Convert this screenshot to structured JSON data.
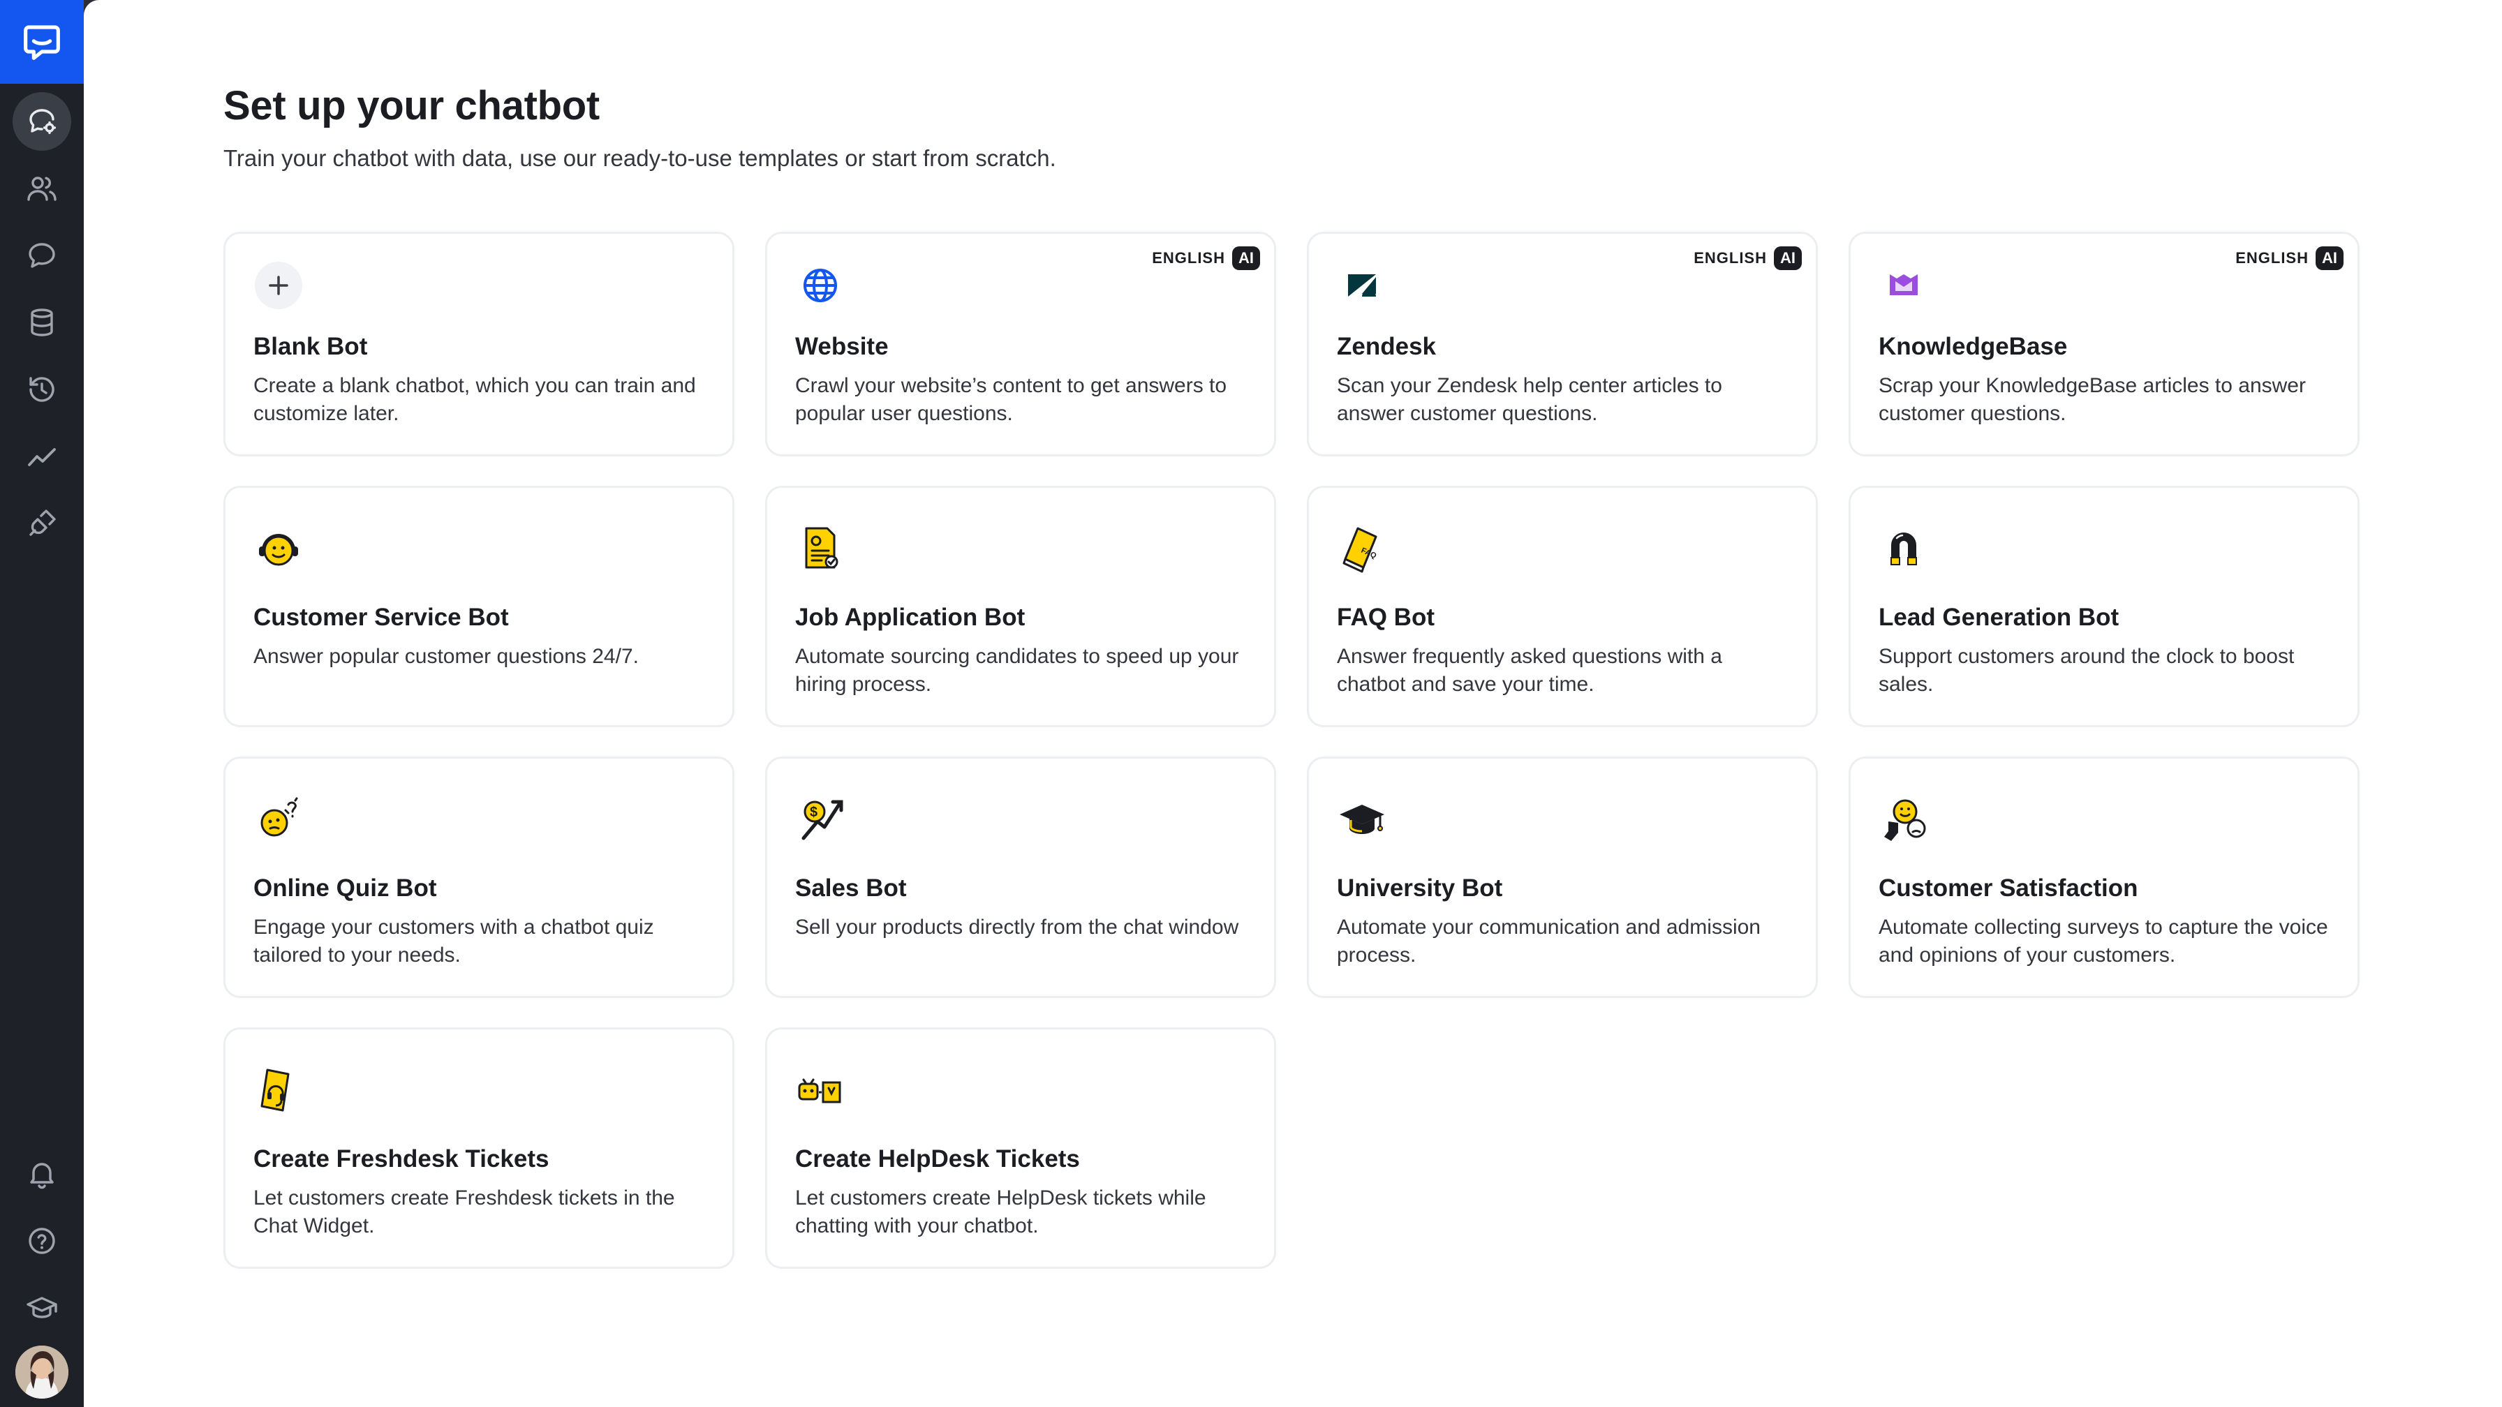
{
  "header": {
    "title": "Set up your chatbot",
    "subtitle": "Train your chatbot with data, use our ready-to-use templates or start from scratch."
  },
  "sidebar": {
    "logo_icon": "chat-bubble-logo-icon",
    "top_items": [
      {
        "icon": "chatbots-icon",
        "active": true
      },
      {
        "icon": "users-icon"
      },
      {
        "icon": "conversations-icon"
      },
      {
        "icon": "database-icon"
      },
      {
        "icon": "history-icon"
      },
      {
        "icon": "reports-icon"
      },
      {
        "icon": "integrations-plug-icon"
      }
    ],
    "bottom_items": [
      {
        "icon": "bell-icon"
      },
      {
        "icon": "help-icon"
      },
      {
        "icon": "academy-icon"
      },
      {
        "icon": "avatar"
      }
    ]
  },
  "cards": [
    {
      "title": "Blank Bot",
      "desc": "Create a blank chatbot, which you can train and customize later.",
      "icon": "plus-icon"
    },
    {
      "title": "Website",
      "desc": "Crawl your website’s content to get answers to popular user questions.",
      "icon": "globe-icon",
      "badge_lang": "ENGLISH",
      "badge_ai": "AI"
    },
    {
      "title": "Zendesk",
      "desc": "Scan your Zendesk help center articles to answer customer questions.",
      "icon": "zendesk-icon",
      "badge_lang": "ENGLISH",
      "badge_ai": "AI"
    },
    {
      "title": "KnowledgeBase",
      "desc": "Scrap your KnowledgeBase articles to answer customer questions.",
      "icon": "knowledgebase-icon",
      "badge_lang": "ENGLISH",
      "badge_ai": "AI"
    },
    {
      "title": "Customer Service Bot",
      "desc": "Answer popular customer questions 24/7.",
      "icon": "headset-smiley-icon"
    },
    {
      "title": "Job Application Bot",
      "desc": "Automate sourcing candidates to speed up your hiring process.",
      "icon": "resume-document-icon"
    },
    {
      "title": "FAQ Bot",
      "desc": "Answer frequently asked questions with a chatbot and save your time.",
      "icon": "faq-book-icon"
    },
    {
      "title": "Lead Generation Bot",
      "desc": "Support customers around the clock to boost sales.",
      "icon": "magnet-icon"
    },
    {
      "title": "Online Quiz Bot",
      "desc": "Engage your customers with a chatbot quiz tailored to your needs.",
      "icon": "quiz-thinking-icon"
    },
    {
      "title": "Sales Bot",
      "desc": "Sell your products directly from the chat window",
      "icon": "money-growth-icon"
    },
    {
      "title": "University Bot",
      "desc": "Automate your communication and admission process.",
      "icon": "graduation-cap-icon"
    },
    {
      "title": "Customer Satisfaction",
      "desc": "Automate collecting surveys to capture the voice and opinions of your customers.",
      "icon": "satisfaction-faces-icon"
    },
    {
      "title": "Create Freshdesk Tickets",
      "desc": "Let customers create Freshdesk tickets in the Chat Widget.",
      "icon": "freshdesk-ticket-icon"
    },
    {
      "title": "Create HelpDesk Tickets",
      "desc": "Let customers create HelpDesk tickets while chatting with your chatbot.",
      "icon": "helpdesk-ticket-icon"
    }
  ],
  "colors": {
    "accent": "#1357F0",
    "sidebar": "#1E2127",
    "illustration_yellow": "#FFD100",
    "knowledgebase_purple": "#9B4DE0"
  }
}
